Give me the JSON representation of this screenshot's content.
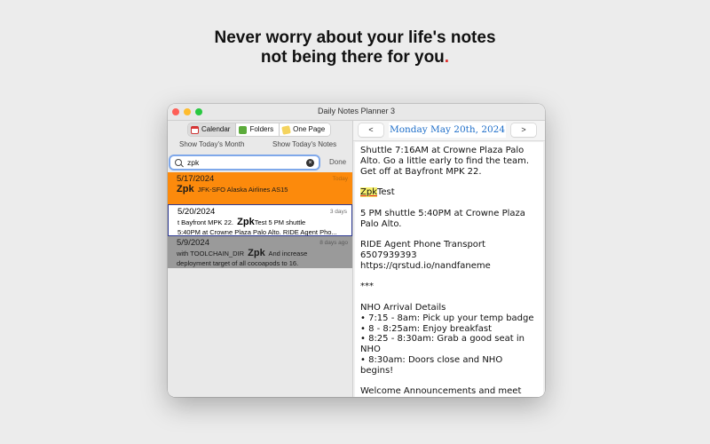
{
  "headline": {
    "line1": "Never worry about your life's notes",
    "line2": "not being there for you",
    "dot": "."
  },
  "window": {
    "title": "Daily Notes Planner 3"
  },
  "toolbar": {
    "segments": [
      {
        "label": "Calendar",
        "icon": "calendar-icon"
      },
      {
        "label": "Folders",
        "icon": "folder-icon"
      },
      {
        "label": "One Page",
        "icon": "page-icon"
      }
    ],
    "show_month": "Show Today's Month",
    "show_notes": "Show Today's Notes"
  },
  "search": {
    "value": "zpk",
    "done": "Done"
  },
  "results": [
    {
      "date": "5/17/2024",
      "ago": "Today",
      "line1_bold": "Zpk",
      "line1_rest": "JFK-SFO Alaska Airlines AS15",
      "color": "#fc8a0c"
    },
    {
      "date": "5/20/2024",
      "ago": "3 days",
      "line1_pre": "t Bayfront MPK 22.",
      "line1_bold": "Zpk",
      "line1_rest": "Test  5 PM shuttle",
      "line2": "5:40PM at Crowne Plaza Palo Alto.  RIDE Agent Pho..."
    },
    {
      "date": "5/9/2024",
      "ago": "8 days ago",
      "line1_pre": "with TOOLCHAIN_DIR",
      "line1_bold": "Zpk",
      "line1_rest": "And increase",
      "line2": "deployment target of all cocoapods to 16.",
      "color": "#9a9a9a"
    }
  ],
  "nav": {
    "prev": "<",
    "next": ">",
    "date": "Monday May 20th, 2024",
    "date_color": "#1e6ec9"
  },
  "note": {
    "p1": "Shuttle 7:16AM at Crowne Plaza Palo Alto. Go a little early to find the team. Get off at Bayfront MPK 22.",
    "p2_highlight": "Zpk",
    "p2_rest": "Test",
    "p3": "5 PM shuttle 5:40PM at Crowne Plaza Palo Alto.",
    "p4": "RIDE Agent Phone Transport\n6507939393\nhttps://qrstud.io/nandfaneme",
    "p5": "***",
    "p6": "NHO Arrival Details\n• 7:15 - 8am: Pick up your temp badge\n• 8 - 8:25am: Enjoy breakfast\n• 8:25 - 8:30am: Grab a good seat in NHO\n• 8:30am: Doors close and NHO begins!",
    "p7": "Welcome Announcements and meet"
  }
}
